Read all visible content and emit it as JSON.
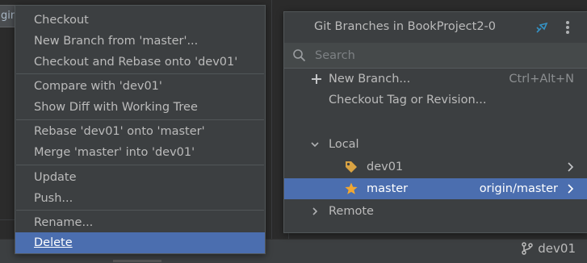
{
  "background": {
    "tab_fragment": "gin",
    "branch_indicator": "dev01"
  },
  "context_menu": {
    "items": [
      {
        "label": "Checkout"
      },
      {
        "label": "New Branch from 'master'..."
      },
      {
        "label": "Checkout and Rebase onto 'dev01'"
      },
      {
        "label": "Compare with 'dev01'"
      },
      {
        "label": "Show Diff with Working Tree"
      },
      {
        "label": "Rebase 'dev01' onto 'master'"
      },
      {
        "label": "Merge 'master' into 'dev01'"
      },
      {
        "label": "Update"
      },
      {
        "label": "Push..."
      },
      {
        "label": "Rename..."
      },
      {
        "label": "Delete",
        "selected": true
      }
    ]
  },
  "git_branches": {
    "title": "Git Branches in BookProject2-0",
    "search_placeholder": "Search",
    "actions": [
      {
        "label": "New Branch...",
        "shortcut": "Ctrl+Alt+N"
      },
      {
        "label": "Checkout Tag or Revision..."
      }
    ],
    "local_label": "Local",
    "local_branches": [
      {
        "name": "dev01",
        "icon": "tag-icon"
      },
      {
        "name": "master",
        "icon": "star-icon",
        "tracking": "origin/master",
        "selected": true
      }
    ],
    "remote_label": "Remote"
  },
  "colors": {
    "selection": "#4b6eaf",
    "tag": "#d9a343",
    "star": "#f0a732",
    "pin": "#3592c4"
  }
}
